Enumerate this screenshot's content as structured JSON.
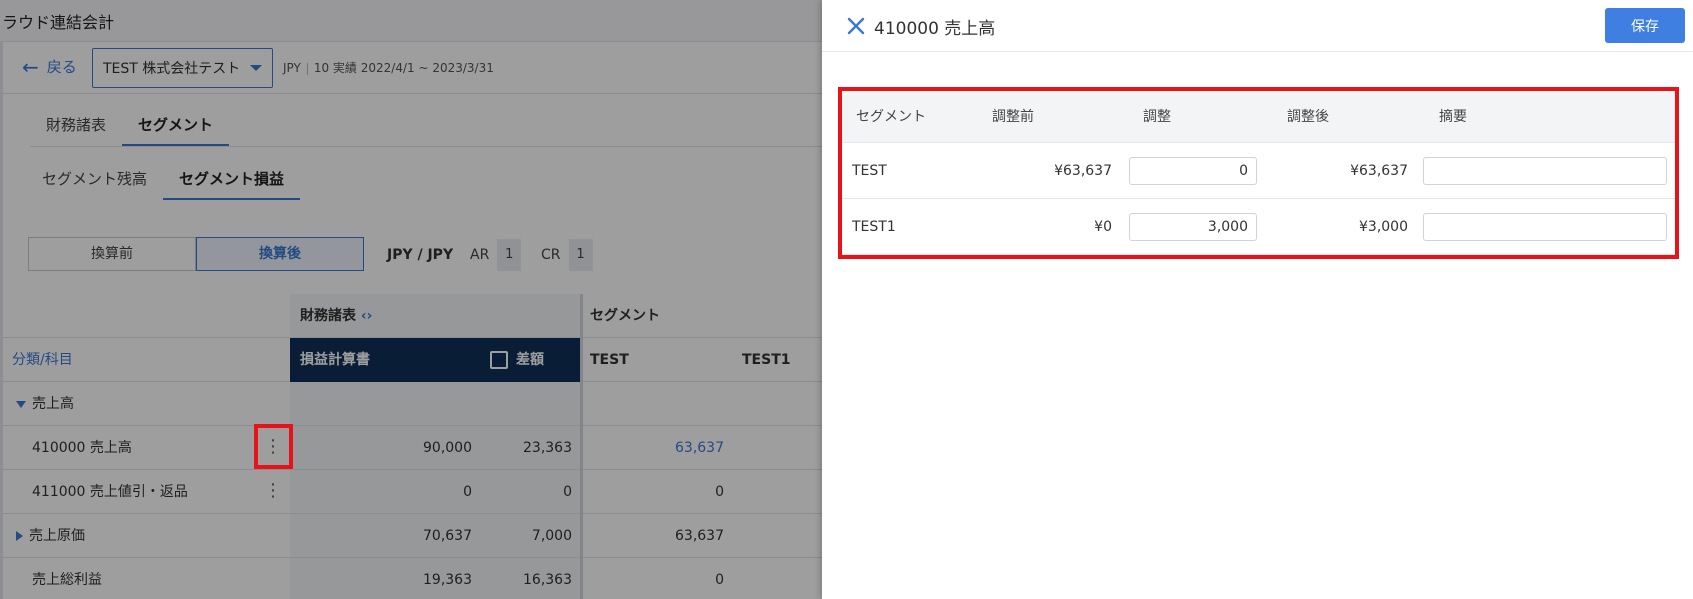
{
  "app": {
    "title": "クラウド連結会計",
    "back_label": "戻る",
    "company": "TEST 株式会社テスト",
    "currency": "JPY",
    "period": "10 実績 2022/4/1 ~ 2023/3/31",
    "tabs_primary": [
      {
        "label": "財務諸表",
        "active": false
      },
      {
        "label": "セグメント",
        "active": true
      }
    ],
    "tabs_secondary": [
      {
        "label": "セグメント残高",
        "active": false
      },
      {
        "label": "セグメント損益",
        "active": true
      }
    ],
    "conversion": {
      "before_label": "換算前",
      "after_label": "換算後",
      "selected": "換算後"
    },
    "rate": {
      "pair": "JPY / JPY",
      "ar_label": "AR",
      "ar_value": "1",
      "cr_label": "CR",
      "cr_value": "1"
    },
    "grid": {
      "group_fin": "財務諸表",
      "group_fin_icon": "chevron-left-right",
      "group_seg": "セグメント",
      "col_account": "分類/科目",
      "col_pl": "損益計算書",
      "col_diff": "差額",
      "col_test": "TEST",
      "col_test1": "TEST1",
      "rows": [
        {
          "label": "売上高",
          "pl": "",
          "diff": "",
          "test": "",
          "group": "expanded"
        },
        {
          "label": "410000 売上高",
          "pl": "90,000",
          "diff": "23,363",
          "test": "63,637",
          "menu": true
        },
        {
          "label": "411000 売上値引・返品",
          "pl": "0",
          "diff": "0",
          "test": "0",
          "menu": true
        },
        {
          "label": "売上原価",
          "pl": "70,637",
          "diff": "7,000",
          "test": "63,637",
          "group": "collapsed"
        },
        {
          "label": "売上総利益",
          "pl": "19,363",
          "diff": "16,363",
          "test": "0"
        }
      ]
    }
  },
  "drawer": {
    "title": "410000 売上高",
    "save_label": "保存",
    "headers": [
      "セグメント",
      "調整前",
      "調整",
      "調整後",
      "摘要"
    ],
    "rows": [
      {
        "segment": "TEST",
        "before": "¥63,637",
        "adjust": "0",
        "after": "¥63,637",
        "memo": ""
      },
      {
        "segment": "TEST1",
        "before": "¥0",
        "adjust": "3,000",
        "after": "¥3,000",
        "memo": ""
      }
    ]
  },
  "colors": {
    "accent": "#3a78d6",
    "save_button": "#3f7fe2",
    "highlight": "#e8121b",
    "table_header_dark": "#0f2f57"
  }
}
